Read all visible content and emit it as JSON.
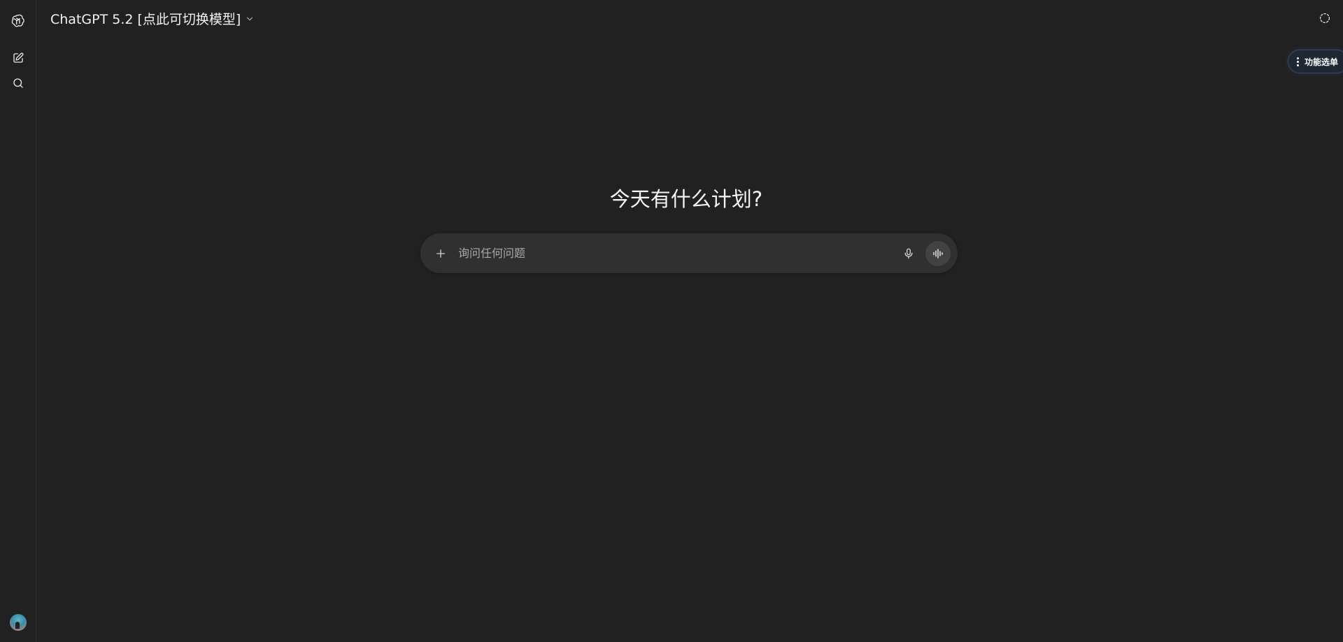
{
  "sidebar": {
    "icons": [
      "openai-logo-icon",
      "new-chat-icon",
      "search-icon",
      "avatar"
    ]
  },
  "header": {
    "model_label": "ChatGPT 5.2 [点此可切换模型]"
  },
  "func_menu": {
    "label": "功能选单"
  },
  "main": {
    "headline": "今天有什么计划?"
  },
  "composer": {
    "placeholder": "询问任何问题",
    "value": ""
  },
  "colors": {
    "background": "#212121",
    "composer": "#303030",
    "voice_button": "#424242",
    "func_menu_bg": "#1f2733",
    "func_menu_border": "#3a4a62"
  }
}
